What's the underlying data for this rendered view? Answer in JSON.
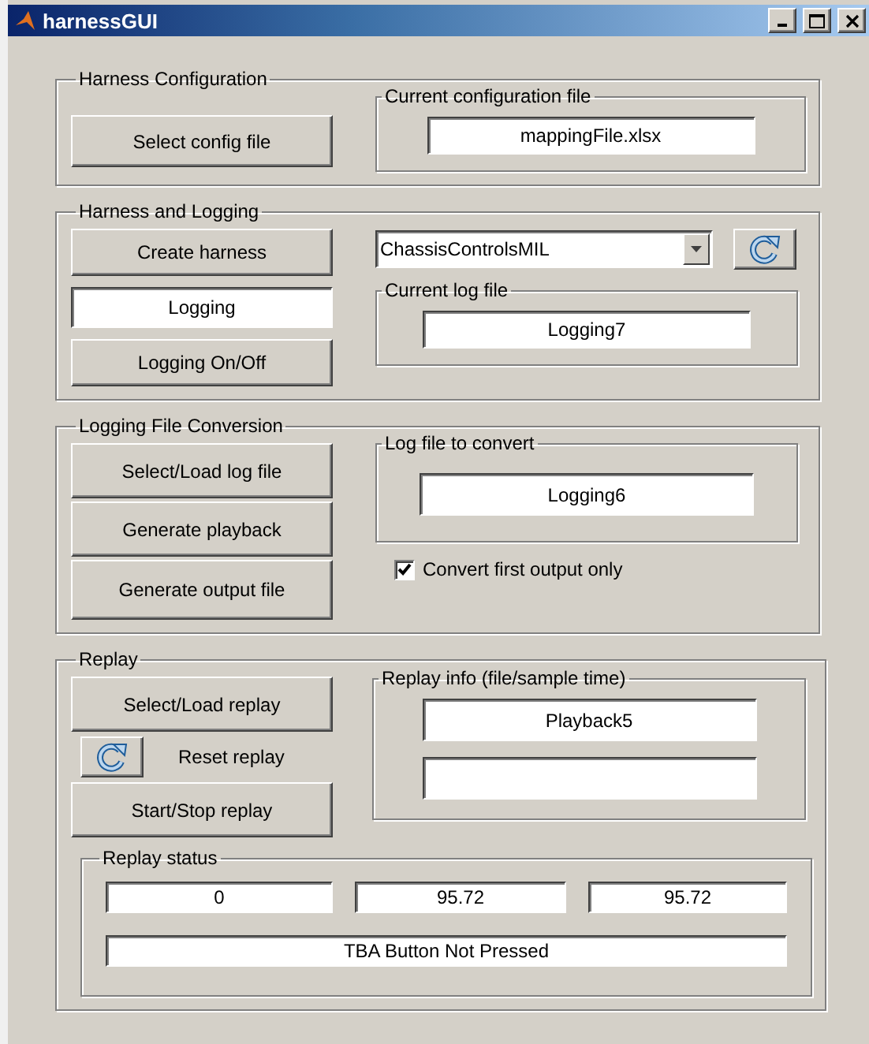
{
  "window": {
    "title": "harnessGUI"
  },
  "config": {
    "title": "Harness Configuration",
    "button": "Select config file",
    "file_panel": {
      "title": "Current configuration file",
      "value": "mappingFile.xlsx"
    }
  },
  "harness": {
    "title": "Harness and Logging",
    "create_button": "Create harness",
    "model_dropdown": {
      "value": "ChassisControlsMIL"
    },
    "logging_field": {
      "value": "Logging"
    },
    "logging_button": "Logging On/Off",
    "log_panel": {
      "title": "Current log file",
      "value": "Logging7"
    }
  },
  "conversion": {
    "title": "Logging File Conversion",
    "buttons": [
      "Select/Load log file",
      "Generate playback",
      "Generate output file"
    ],
    "convert_panel": {
      "title": "Log file to convert",
      "value": "Logging6"
    },
    "checkbox": {
      "label": "Convert first output only",
      "checked": true
    }
  },
  "replay": {
    "title": "Replay",
    "select_button": "Select/Load replay",
    "reset_label": "Reset replay",
    "start_button": "Start/Stop replay",
    "info_panel": {
      "title": "Replay info (file/sample time)",
      "fields": [
        "Playback5"
      ]
    },
    "status": {
      "title": "Replay status",
      "values": [
        "0",
        "95.72",
        "95.72"
      ],
      "message": "TBA Button Not Pressed"
    }
  }
}
